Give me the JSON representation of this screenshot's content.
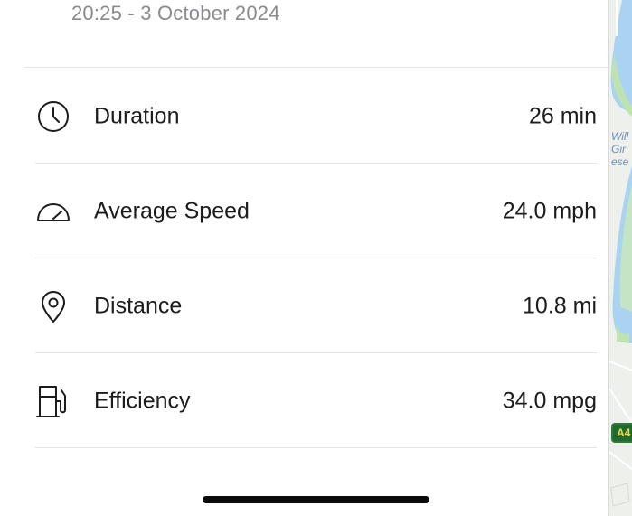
{
  "trip": {
    "timestamp": "20:25 - 3 October 2024"
  },
  "stats": [
    {
      "label": "Duration",
      "value": "26 min",
      "icon": "clock-icon"
    },
    {
      "label": "Average Speed",
      "value": "24.0 mph",
      "icon": "speedometer-icon"
    },
    {
      "label": "Distance",
      "value": "10.8 mi",
      "icon": "location-pin-icon"
    },
    {
      "label": "Efficiency",
      "value": "34.0 mpg",
      "icon": "fuel-pump-icon"
    }
  ],
  "map": {
    "place_label": "Will\nGir\nese",
    "road_badge": "A4"
  },
  "colors": {
    "text": "#1c1c1e",
    "secondary_text": "#8a8a8e",
    "divider": "#e4e4e6",
    "water": "#a9d3f1",
    "park": "#bfe3b0",
    "road_badge_bg": "#1f6b2e",
    "road_badge_text": "#f5d64a"
  }
}
